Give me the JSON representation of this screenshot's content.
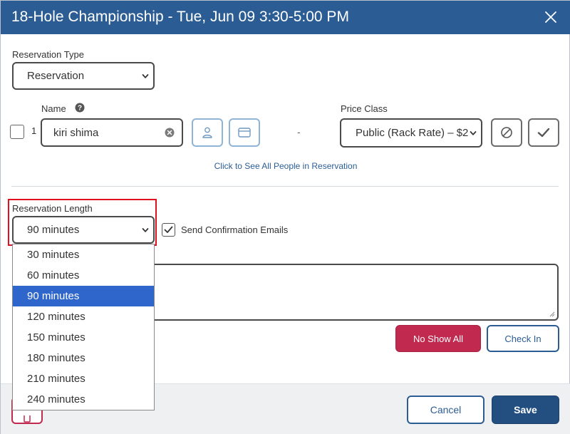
{
  "header": {
    "title": "18-Hole Championship - Tue, Jun 09 3:30-5:00 PM"
  },
  "reservation_type": {
    "label": "Reservation Type",
    "value": "Reservation"
  },
  "player": {
    "row_number": "1",
    "name_label": "Name",
    "name_value": "kiri shima",
    "separator": "-",
    "price_class_label": "Price Class",
    "price_class_value": "Public (Rack Rate) – $2"
  },
  "link_text": "Click to See All People in Reservation",
  "reservation_length": {
    "label": "Reservation Length",
    "value": "90 minutes",
    "options": [
      "30 minutes",
      "60 minutes",
      "90 minutes",
      "120 minutes",
      "150 minutes",
      "180 minutes",
      "210 minutes",
      "240 minutes"
    ],
    "selected_index": 2
  },
  "send_confirmation": {
    "label": "Send Confirmation Emails",
    "checked": true
  },
  "buttons": {
    "no_show_all": "No Show All",
    "check_in": "Check In",
    "cancel": "Cancel",
    "save": "Save"
  },
  "colors": {
    "header": "#2b5d94",
    "accent_red": "#c1294f",
    "highlight": "#e0111e",
    "selected_option": "#2f66cb"
  },
  "icons": {
    "close": "close-icon",
    "help": "help-circle-icon",
    "clear": "clear-circle-icon",
    "person": "person-icon",
    "card": "credit-card-icon",
    "no_show": "no-symbol-icon",
    "check": "checkmark-icon",
    "delete": "trash-icon"
  }
}
